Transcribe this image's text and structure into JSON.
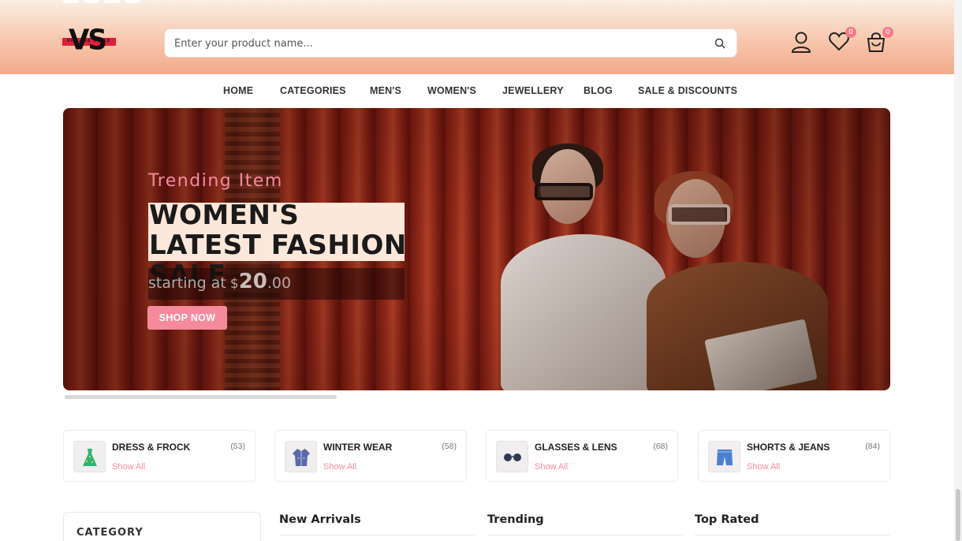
{
  "header": {
    "logo_text": "VS",
    "logo_tagline": "VILLAGE STYLE",
    "search_placeholder": "Enter your product name...",
    "wishlist_count": "0",
    "cart_count": "0"
  },
  "nav": {
    "items": [
      "HOME",
      "CATEGORIES",
      "MEN'S",
      "WOMEN'S",
      "JEWELLERY",
      "BLOG",
      "SALE & DISCOUNTS"
    ]
  },
  "banner": {
    "subtitle": "Trending Item",
    "title": "WOMEN'S LATEST FASHION SALE",
    "price_label": "starting at",
    "currency": "$",
    "price_whole": "20",
    "price_decimal": ".00",
    "button": "SHOP NOW"
  },
  "categories": [
    {
      "name": "DRESS & FROCK",
      "count": "(53)",
      "link": "Show All",
      "icon": "dress-icon"
    },
    {
      "name": "WINTER WEAR",
      "count": "(58)",
      "link": "Show All",
      "icon": "coat-icon"
    },
    {
      "name": "GLASSES & LENS",
      "count": "(68)",
      "link": "Show All",
      "icon": "glasses-icon"
    },
    {
      "name": "SHORTS & JEANS",
      "count": "(84)",
      "link": "Show All",
      "icon": "shorts-icon"
    }
  ],
  "sidebar": {
    "title": "CATEGORY"
  },
  "sections": [
    "New Arrivals",
    "Trending",
    "Top Rated"
  ],
  "colors": {
    "accent": "#f48a9c",
    "header_gradient": "#f3a98a"
  }
}
